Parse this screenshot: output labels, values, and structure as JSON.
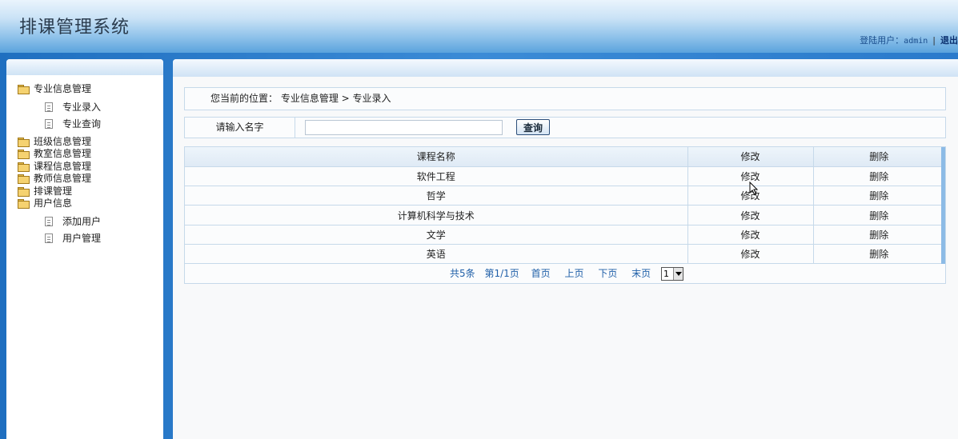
{
  "header": {
    "title": "排课管理系统",
    "user_label": "登陆用户：",
    "username": "admin",
    "separator": "|",
    "logout": "退出"
  },
  "sidebar": {
    "groups": [
      {
        "label": "专业信息管理",
        "children": [
          "专业录入",
          "专业查询"
        ]
      },
      {
        "label": "班级信息管理",
        "children": []
      },
      {
        "label": "教室信息管理",
        "children": []
      },
      {
        "label": "课程信息管理",
        "children": []
      },
      {
        "label": "教师信息管理",
        "children": []
      },
      {
        "label": "排课管理",
        "children": []
      },
      {
        "label": "用户信息",
        "children": [
          "添加用户",
          "用户管理"
        ]
      }
    ]
  },
  "breadcrumb": {
    "prefix": "您当前的位置：",
    "path": "专业信息管理 > 专业录入"
  },
  "search": {
    "label": "请输入名字",
    "value": "",
    "button": "查询"
  },
  "table": {
    "headers": [
      "课程名称",
      "修改",
      "删除"
    ],
    "rows": [
      [
        "软件工程",
        "修改",
        "删除"
      ],
      [
        "哲学",
        "修改",
        "删除"
      ],
      [
        "计算机科学与技术",
        "修改",
        "删除"
      ],
      [
        "文学",
        "修改",
        "删除"
      ],
      [
        "英语",
        "修改",
        "删除"
      ]
    ]
  },
  "pager": {
    "total": "共5条",
    "page_info": "第1/1页",
    "first": "首页",
    "prev": "上页",
    "next": "下页",
    "last": "末页",
    "selected_page": "1"
  }
}
